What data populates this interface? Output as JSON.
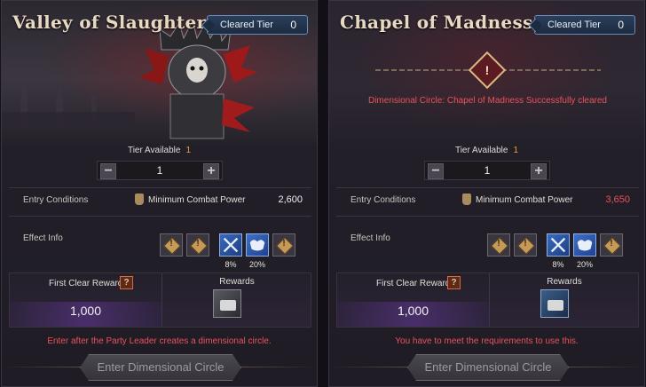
{
  "panels": [
    {
      "title": "Valley of Slaughter",
      "cleared_label": "Cleared Tier",
      "cleared_value": "0",
      "tier_label": "Tier Available",
      "tier_value": "1",
      "stepper_value": "1",
      "entry_label": "Entry Conditions",
      "cp_label": "Minimum Combat Power",
      "cp_value": "2,600",
      "effect_label": "Effect Info",
      "effects": [
        {
          "icon": "locked-icon"
        },
        {
          "icon": "locked-icon"
        },
        {
          "icon": "sword-icon",
          "pct": "8%"
        },
        {
          "icon": "muscle-icon",
          "pct": "20%"
        },
        {
          "icon": "locked-icon"
        }
      ],
      "first_clear_label": "First Clear Reward",
      "first_clear_value": "1,000",
      "rewards_label": "Rewards",
      "notice": "Enter after the Party Leader creates a dimensional circle.",
      "enter_label": "Enter Dimensional Circle"
    },
    {
      "title": "Chapel of Madness",
      "cleared_label": "Cleared Tier",
      "cleared_value": "0",
      "success_text": "Dimensional Circle: Chapel of Madness Successfully cleared",
      "tier_label": "Tier Available",
      "tier_value": "1",
      "stepper_value": "1",
      "entry_label": "Entry Conditions",
      "cp_label": "Minimum Combat Power",
      "cp_value": "3,650",
      "effect_label": "Effect Info",
      "effects": [
        {
          "icon": "locked-icon"
        },
        {
          "icon": "locked-icon"
        },
        {
          "icon": "sword-icon",
          "pct": "8%"
        },
        {
          "icon": "muscle-icon",
          "pct": "20%"
        },
        {
          "icon": "locked-icon"
        }
      ],
      "first_clear_label": "First Clear Reward",
      "first_clear_value": "1,000",
      "rewards_label": "Rewards",
      "notice": "You have to meet the requirements to use this.",
      "enter_label": "Enter Dimensional Circle"
    }
  ],
  "glyphs": {
    "minus": "−",
    "plus": "+",
    "question": "?",
    "bang": "!"
  },
  "colors": {
    "warning": "#e9525a",
    "tier_value": "#e6a33a",
    "cleared_border": "#6b8db3"
  }
}
